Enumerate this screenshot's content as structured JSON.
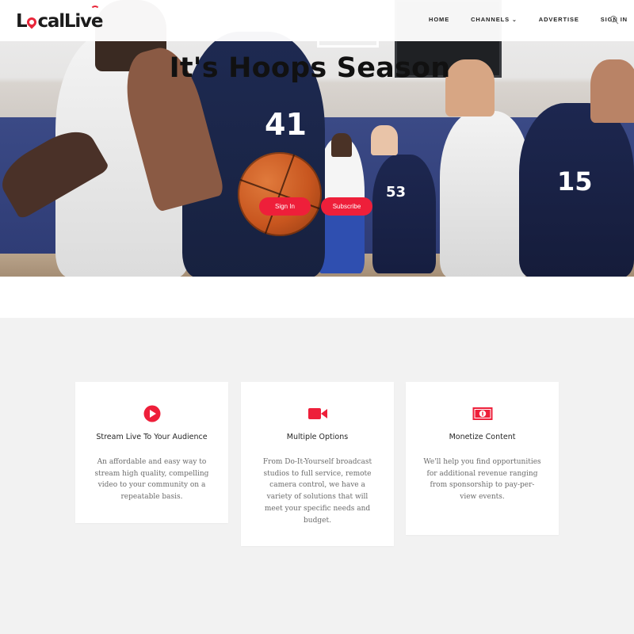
{
  "brand": {
    "logo_text_pre": "L",
    "logo_text_mid": "cal",
    "logo_text_post": "Live",
    "accent_color": "#ee1f3a"
  },
  "nav": {
    "items": [
      {
        "label": "HOME"
      },
      {
        "label": "CHANNELS"
      },
      {
        "label": "ADVERTISE"
      },
      {
        "label": "SIGN IN"
      }
    ],
    "search_icon": "search-icon"
  },
  "hero": {
    "title": "It's Hoops Season",
    "sign_in_label": "Sign In",
    "subscribe_label": "Subscribe",
    "jersey_numbers": [
      "41",
      "53",
      "15"
    ]
  },
  "features": [
    {
      "icon": "play-circle-icon",
      "title": "Stream Live To Your Audience",
      "text": "An affordable and easy way to stream high quality, compelling video to your community on a repeatable basis."
    },
    {
      "icon": "video-camera-icon",
      "title": "Multiple Options",
      "text": "From Do-It-Yourself broadcast studios to full service, remote camera control, we have a variety of solutions that will meet your specific needs and budget."
    },
    {
      "icon": "money-bill-icon",
      "title": "Monetize Content",
      "text": "We'll help you find opportunities for additional revenue ranging from sponsorship to pay-per-view events."
    }
  ]
}
